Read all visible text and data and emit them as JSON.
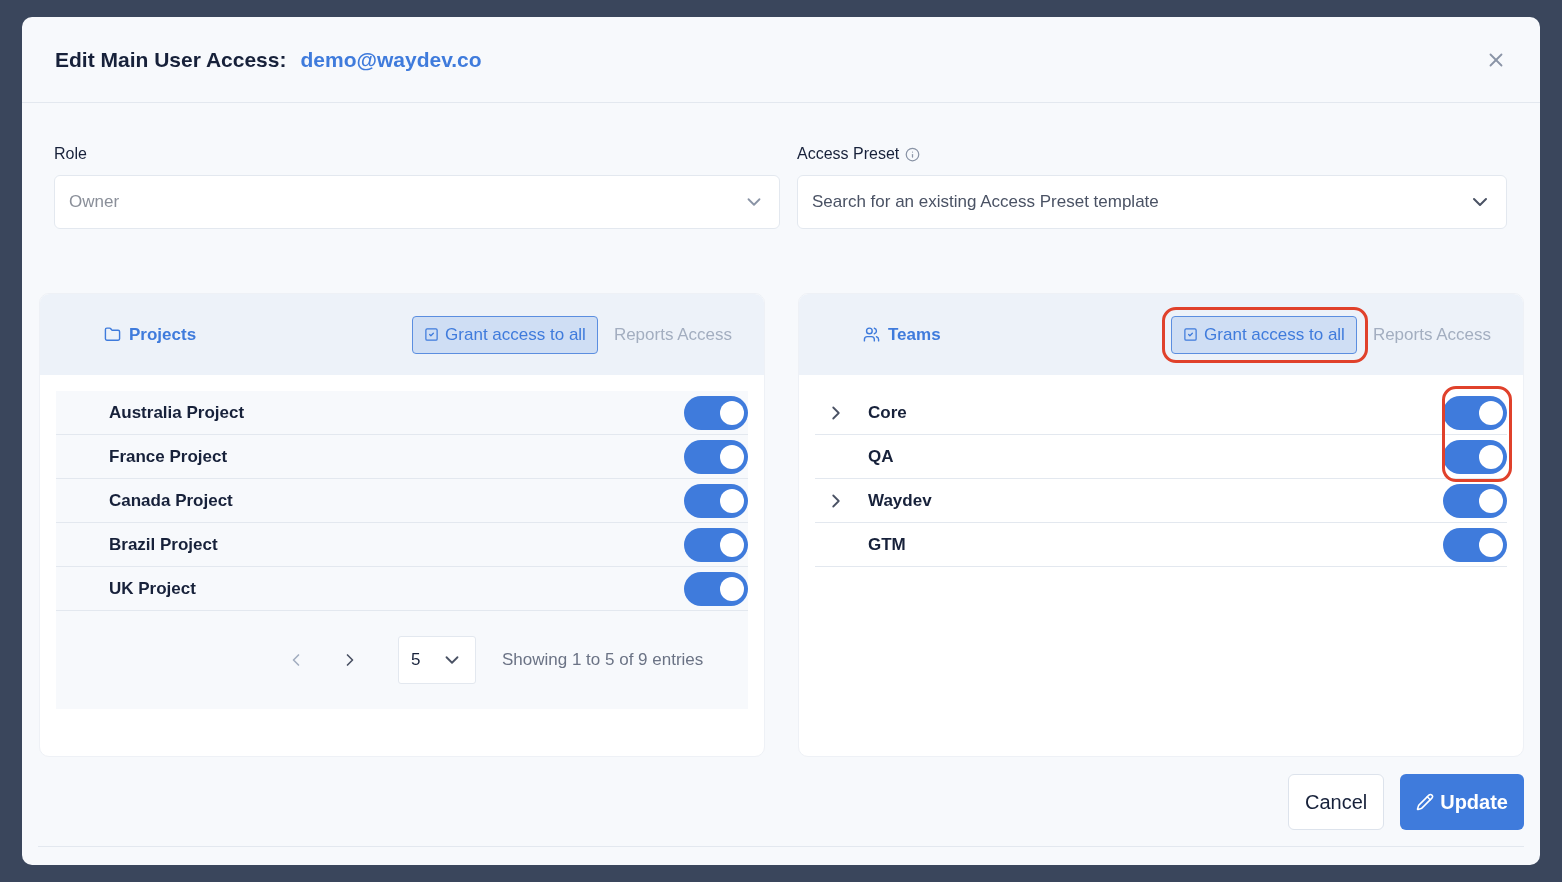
{
  "modal": {
    "title": "Edit Main User Access:",
    "email": "demo@waydev.co"
  },
  "role": {
    "label": "Role",
    "value": "Owner"
  },
  "access_preset": {
    "label": "Access Preset",
    "placeholder": "Search for an existing Access Preset template"
  },
  "projects": {
    "title": "Projects",
    "grant_all": {
      "label": "Grant access to all",
      "highlighted": false
    },
    "reports_access": "Reports Access",
    "rows": [
      {
        "name": "Australia Project",
        "on": true
      },
      {
        "name": "France Project",
        "on": true
      },
      {
        "name": "Canada Project",
        "on": true
      },
      {
        "name": "Brazil Project",
        "on": true
      },
      {
        "name": "UK Project",
        "on": true
      }
    ],
    "page_size": "5",
    "entries_info": "Showing 1 to 5 of 9 entries"
  },
  "teams": {
    "title": "Teams",
    "grant_all": {
      "label": "Grant access to all",
      "highlighted": true
    },
    "reports_access": "Reports Access",
    "rows": [
      {
        "name": "Core",
        "on": true,
        "expandable": true,
        "highlighted": true
      },
      {
        "name": "QA",
        "on": true,
        "expandable": false,
        "highlighted": true
      },
      {
        "name": "Waydev",
        "on": true,
        "expandable": true,
        "highlighted": false
      },
      {
        "name": "GTM",
        "on": true,
        "expandable": false,
        "highlighted": false
      }
    ]
  },
  "buttons": {
    "cancel": "Cancel",
    "update": "Update"
  }
}
